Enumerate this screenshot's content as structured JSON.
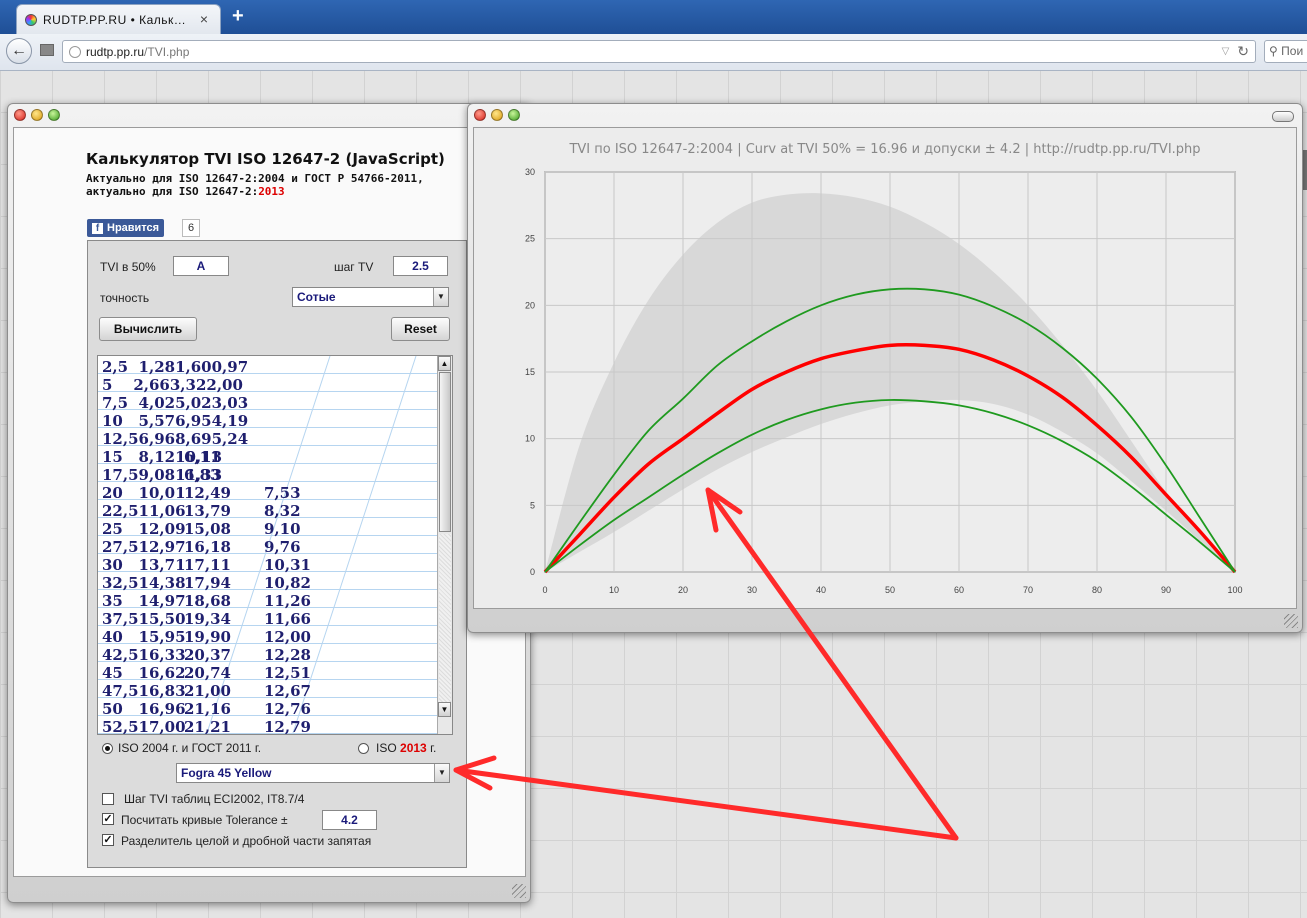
{
  "browser": {
    "tab_title": "RUDTP.PP.RU • Кальк…",
    "tab_close": "×",
    "new_tab": "+",
    "url_host": "rudtp.pp.ru",
    "url_path": "/TVI.php",
    "search_placeholder": "Пои"
  },
  "calculator": {
    "title": "Калькулятор TVI ISO 12647-2 (JavaScript)",
    "subtitle_line1": "Актуально для ISO 12647-2:2004 и ГОСТ Р 54766-2011,",
    "subtitle_line2_prefix": "актуально для ISO 12647-2:",
    "subtitle_line2_year": "2013",
    "like_label": "Нравится",
    "like_count": "6",
    "tvi50_label": "TVI в 50%",
    "tvi50_value": "A",
    "step_label": "шаг TV",
    "step_value": "2.5",
    "precision_label": "точность",
    "precision_value": "Сотые",
    "compute_button": "Вычислить",
    "reset_button": "Reset",
    "results": [
      [
        "2,5  1,281,600,97",
        "",
        ""
      ],
      [
        "5    2,663,322,00",
        "",
        ""
      ],
      [
        "7,5  4,025,023,03",
        "",
        ""
      ],
      [
        "10   5,576,954,19",
        "",
        ""
      ],
      [
        "12,56,968,695,24",
        "",
        ""
      ],
      [
        "15   8,1210,13",
        "6,11",
        ""
      ],
      [
        "17,59,0811,33",
        "6,83",
        ""
      ],
      [
        "20   10,01",
        "12,49",
        "7,53"
      ],
      [
        "22,511,06",
        "13,79",
        "8,32"
      ],
      [
        "25   12,09",
        "15,08",
        "9,10"
      ],
      [
        "27,512,97",
        "16,18",
        "9,76"
      ],
      [
        "30   13,71",
        "17,11",
        "10,31"
      ],
      [
        "32,514,38",
        "17,94",
        "10,82"
      ],
      [
        "35   14,97",
        "18,68",
        "11,26"
      ],
      [
        "37,515,50",
        "19,34",
        "11,66"
      ],
      [
        "40   15,95",
        "19,90",
        "12,00"
      ],
      [
        "42,516,33",
        "20,37",
        "12,28"
      ],
      [
        "45   16,62",
        "20,74",
        "12,51"
      ],
      [
        "47,516,83",
        "21,00",
        "12,67"
      ],
      [
        "50   16,96",
        "21,16",
        "12,76"
      ],
      [
        "52,517,00",
        "21,21",
        "12,79"
      ]
    ],
    "radio_iso2004": "ISO 2004 г. и ГОСТ 2011 г.",
    "radio_iso2013_prefix": "ISO",
    "radio_iso2013_year": "2013",
    "radio_iso2013_suffix": "г.",
    "profile_value": "Fogra 45 Yellow",
    "check_eci": "Шаг TVI таблиц ECI2002, IT8.7/4",
    "check_tolerance": "Посчитать кривые Tolerance ±",
    "tolerance_value": "4.2",
    "check_comma": "Разделитель целой и дробной части запятая"
  },
  "chart_data": {
    "type": "area",
    "title": "TVI по ISO 12647-2:2004 | Curv at TVI 50% = 16.96 и допуски ± 4.2 | http://rudtp.pp.ru/TVI.php",
    "xlim": [
      0,
      100
    ],
    "ylim": [
      0,
      30
    ],
    "xticks": [
      0,
      10,
      20,
      30,
      40,
      50,
      60,
      70,
      80,
      90,
      100
    ],
    "yticks": [
      0,
      5,
      10,
      15,
      20,
      25,
      30
    ],
    "grid": true,
    "x": [
      0,
      5,
      10,
      15,
      20,
      25,
      30,
      35,
      40,
      45,
      50,
      55,
      60,
      65,
      70,
      75,
      80,
      85,
      90,
      95,
      100
    ],
    "series": [
      {
        "values": [
          0,
          9.5,
          15.7,
          20.4,
          23.8,
          26.2,
          27.7,
          28.3,
          28.4,
          28.1,
          27.4,
          26.2,
          24.6,
          22.5,
          20.0,
          17.0,
          13.6,
          9.8,
          6.0,
          2.8,
          0
        ],
        "color": "#d8d8d8"
      },
      {
        "values": [
          0,
          1.5,
          3.0,
          4.6,
          6.2,
          7.7,
          9.0,
          10.1,
          11.1,
          11.9,
          12.5,
          12.8,
          12.9,
          12.6,
          11.8,
          10.5,
          8.9,
          6.8,
          4.6,
          2.3,
          0
        ],
        "color": "#d8d8d8"
      },
      {
        "values": [
          0,
          2.8,
          5.6,
          8.1,
          10.0,
          11.9,
          13.7,
          15.0,
          16.0,
          16.6,
          17.0,
          17.0,
          16.7,
          15.9,
          14.7,
          13.1,
          11.0,
          8.6,
          5.8,
          3.0,
          0
        ],
        "color": "#ff0000"
      },
      {
        "values": [
          0,
          3.7,
          7.3,
          10.6,
          13.0,
          15.5,
          17.3,
          18.8,
          20.0,
          20.8,
          21.2,
          21.2,
          20.8,
          19.9,
          18.6,
          16.8,
          14.5,
          11.6,
          8.0,
          4.0,
          0
        ],
        "color": "#1f9a1f"
      },
      {
        "values": [
          0,
          2.0,
          3.9,
          5.6,
          7.3,
          8.9,
          10.3,
          11.4,
          12.2,
          12.7,
          12.9,
          12.8,
          12.5,
          11.9,
          11.0,
          9.8,
          8.3,
          6.4,
          4.3,
          2.2,
          0
        ],
        "color": "#1f9a1f"
      }
    ]
  },
  "colors": {
    "accent_red": "#ff0000",
    "tolerance_green": "#1f9a1f",
    "band_gray": "#d8d8d8",
    "results_text": "#1f1f6e"
  }
}
